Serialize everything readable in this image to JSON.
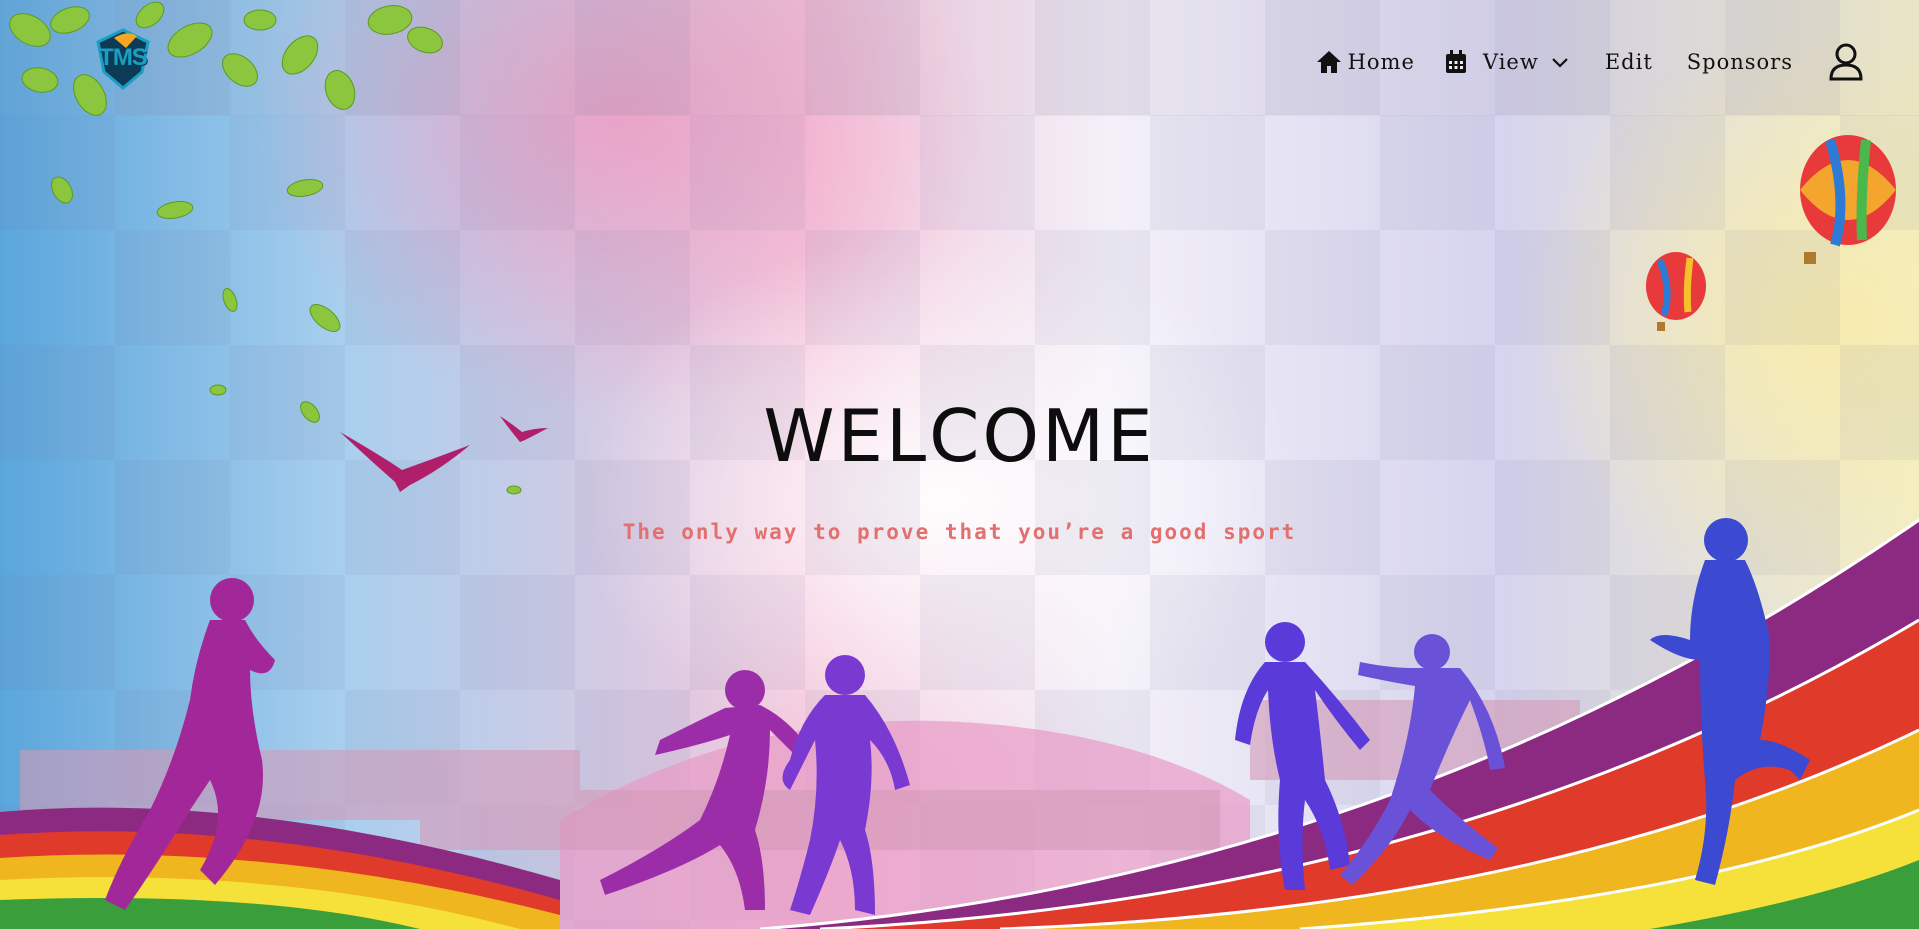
{
  "logo": {
    "text": "TMS"
  },
  "nav": {
    "home_label": "Home",
    "view_label": "View",
    "edit_label": "Edit",
    "sponsors_label": "Sponsors"
  },
  "hero": {
    "title": "WELCOME",
    "tagline": "The only way to prove that you’re a good sport"
  },
  "colors": {
    "tagline": "#e2706e",
    "nav_text": "#111111",
    "logo": "#1a9fc4"
  },
  "icons": {
    "home": "home-icon",
    "view": "calendar-icon",
    "view_dropdown": "chevron-down-icon",
    "user": "user-icon"
  }
}
